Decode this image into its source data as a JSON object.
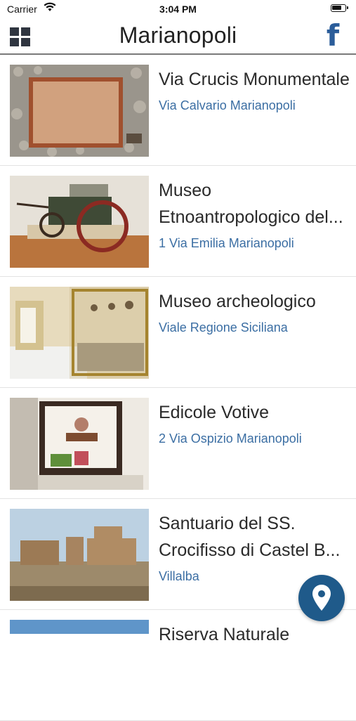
{
  "status_bar": {
    "carrier": "Carrier",
    "time": "3:04 PM"
  },
  "nav": {
    "title": "Marianopoli",
    "facebook_glyph": "f",
    "menu_icon": "grid-icon",
    "fb_icon": "facebook-icon"
  },
  "items": [
    {
      "name": "Via Crucis Monumentale",
      "address": "Via Calvario Marianopoli"
    },
    {
      "name": "Museo Etnoantropologico del...",
      "address": "1 Via Emilia Marianopoli"
    },
    {
      "name": "Museo archeologico",
      "address": "Viale Regione Siciliana"
    },
    {
      "name": "Edicole Votive",
      "address": "2 Via Ospizio Marianopoli"
    },
    {
      "name": "Santuario del SS. Crocifisso di Castel B...",
      "address": "Villalba"
    },
    {
      "name": "Riserva Naturale",
      "address": ""
    }
  ],
  "fab": {
    "icon": "map-pin-icon"
  },
  "colors": {
    "accent": "#1f5a8a",
    "link": "#3b6ea3",
    "facebook": "#2b5d9a"
  }
}
